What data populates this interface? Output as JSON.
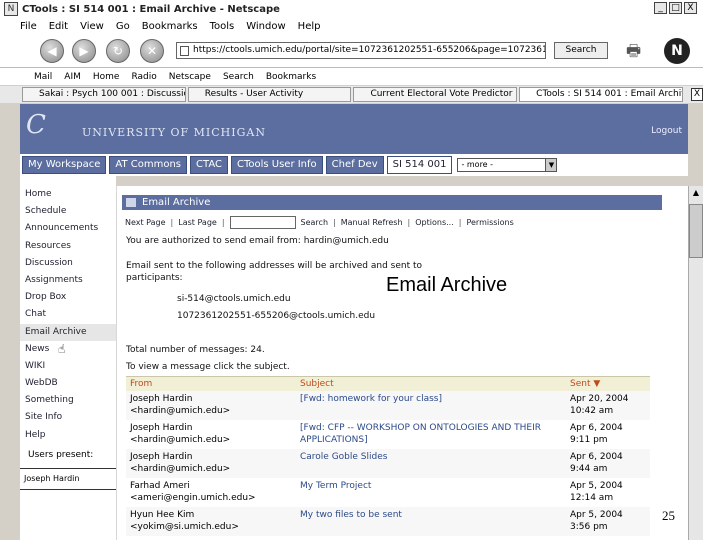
{
  "window": {
    "title": "CTools : SI 514 001 : Email Archive - Netscape",
    "app_icon": "netscape-icon",
    "btn_min": "_",
    "btn_max": "□",
    "btn_close": "X"
  },
  "menu": [
    "File",
    "Edit",
    "View",
    "Go",
    "Bookmarks",
    "Tools",
    "Window",
    "Help"
  ],
  "nav": {
    "back": "◀",
    "forward": "▶",
    "reload": "↻",
    "stop": "✕",
    "url": "https://ctools.umich.edu/portal/site=1072361202551-655206&page=1072361202551-655206...",
    "search_label": "Search",
    "print_glyph": "🖶",
    "netscape_glyph": "N"
  },
  "bookmarks": [
    "Mail",
    "AIM",
    "Home",
    "Radio",
    "Netscape",
    "Search",
    "Bookmarks"
  ],
  "browser_tabs": [
    {
      "label": "Sakai : Psych 100 001 : Discussion",
      "active": false
    },
    {
      "label": "Results - User Activity",
      "active": false
    },
    {
      "label": "Current Electoral Vote Predictor 2004",
      "active": false
    },
    {
      "label": "CTools : SI 514 001 : Email Archive",
      "active": true
    }
  ],
  "tab_close": "X",
  "header": {
    "logo": "C",
    "umich": "UNIVERSITY OF MICHIGAN",
    "logout": "Logout"
  },
  "site_tabs": [
    {
      "label": "My Workspace",
      "active": false
    },
    {
      "label": "AT Commons",
      "active": false
    },
    {
      "label": "CTAC",
      "active": false
    },
    {
      "label": "CTools User Info",
      "active": false
    },
    {
      "label": "Chef Dev",
      "active": false
    },
    {
      "label": "SI 514 001",
      "active": true
    }
  ],
  "more_select": "- more -",
  "more_arrow": "▼",
  "left_nav": [
    "Home",
    "Schedule",
    "Announcements",
    "Resources",
    "Discussion",
    "Assignments",
    "Drop Box",
    "Chat",
    "Email Archive",
    "News",
    "WIKI",
    "WebDB",
    "Something",
    "Site Info",
    "Help"
  ],
  "left_nav_selected": "Email Archive",
  "users_present_label": "Users present:",
  "users_present": [
    "Joseph Hardin"
  ],
  "tool": {
    "title": "Email Archive",
    "toolbar": {
      "next": "Next Page",
      "last": "Last Page",
      "search": "Search",
      "manual_refresh": "Manual Refresh",
      "options": "Options...",
      "permissions": "Permissions",
      "sep": "|"
    },
    "authorized_text": "You are authorized to send email from:  hardin@umich.edu",
    "archived_text_1": "Email sent to the following addresses will be archived and sent to",
    "archived_text_2": "participants:",
    "addresses": [
      "si-514@ctools.umich.edu",
      "1072361202551-655206@ctools.umich.edu"
    ],
    "total_label": "Total number of messages: 24.",
    "view_hint": "To view a message click the subject.",
    "columns": {
      "from": "From",
      "subject": "Subject",
      "sent": "Sent ▼"
    },
    "messages": [
      {
        "from_name": "Joseph Hardin",
        "from_email": "<hardin@umich.edu>",
        "subject": "[Fwd: homework for your class]",
        "subject2": "",
        "date": "Apr 20, 2004",
        "time": "10:42 am"
      },
      {
        "from_name": "Joseph Hardin",
        "from_email": "<hardin@umich.edu>",
        "subject": "[Fwd: CFP -- WORKSHOP ON ONTOLOGIES AND THEIR",
        "subject2": "APPLICATIONS]",
        "date": "Apr 6, 2004",
        "time": "9:11 pm"
      },
      {
        "from_name": "Joseph Hardin",
        "from_email": "<hardin@umich.edu>",
        "subject": "Carole Goble Slides",
        "subject2": "",
        "date": "Apr 6, 2004",
        "time": "9:44 am"
      },
      {
        "from_name": "Farhad Ameri",
        "from_email": "<ameri@engin.umich.edu>",
        "subject": "My Term Project",
        "subject2": "",
        "date": "Apr 5, 2004",
        "time": "12:14 am"
      },
      {
        "from_name": "Hyun Hee Kim",
        "from_email": "<yokim@si.umich.edu>",
        "subject": "My two files to be sent",
        "subject2": "",
        "date": "Apr 5, 2004",
        "time": "3:56 pm"
      }
    ]
  },
  "overlay_title": "Email Archive",
  "page_number": "25",
  "colors": {
    "header_blue": "#5b6e9f",
    "table_header": "#f1f0d6",
    "sent_header_text": "#c04a1a"
  }
}
